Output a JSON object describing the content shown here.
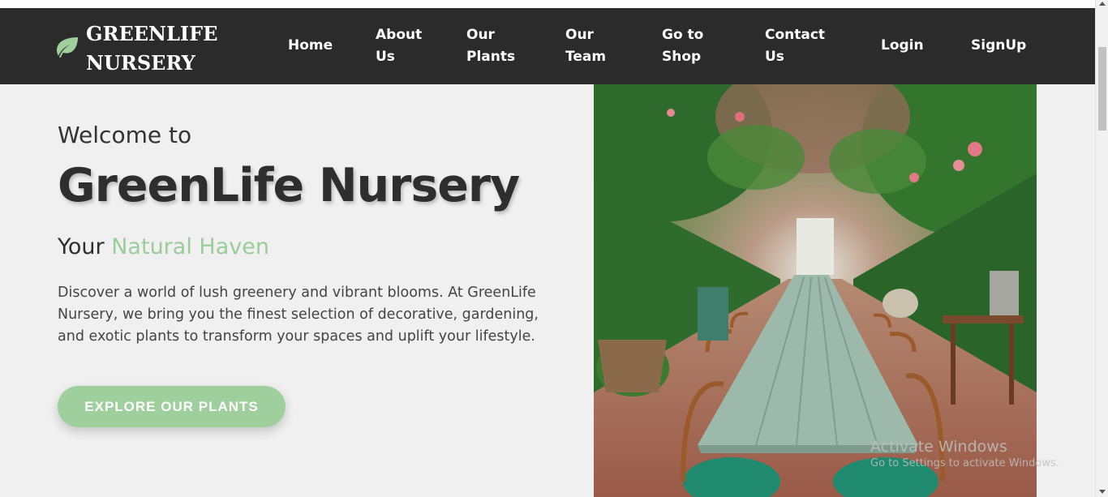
{
  "brand": {
    "line1": "GREENLIFE",
    "line2": "NURSERY",
    "icon": "leaf-icon",
    "icon_color": "#9fcf9c"
  },
  "nav": {
    "home": "Home",
    "about": [
      "About",
      "Us"
    ],
    "plants": [
      "Our",
      "Plants"
    ],
    "team": [
      "Our",
      "Team"
    ],
    "shop": [
      "Go to",
      "Shop"
    ],
    "contact": [
      "Contact",
      "Us"
    ],
    "login": "Login",
    "signup": "SignUp"
  },
  "hero": {
    "welcome": "Welcome to",
    "title": "GreenLife Nursery",
    "tagline_prefix": "Your ",
    "tagline_accent": "Natural Haven",
    "description": "Discover a world of lush greenery and vibrant blooms. At GreenLife Nursery, we bring you the finest selection of decorative, gardening, and exotic plants to transform your spaces and uplift your lifestyle.",
    "cta": "EXPLORE OUR PLANTS",
    "image": "greenhouse-dining-photo"
  },
  "watermark": {
    "line1": "Activate Windows",
    "line2": "Go to Settings to activate Windows."
  },
  "colors": {
    "navbar": "#2b2b2b",
    "accent": "#9fcf9c",
    "background": "#f0f0f0"
  }
}
